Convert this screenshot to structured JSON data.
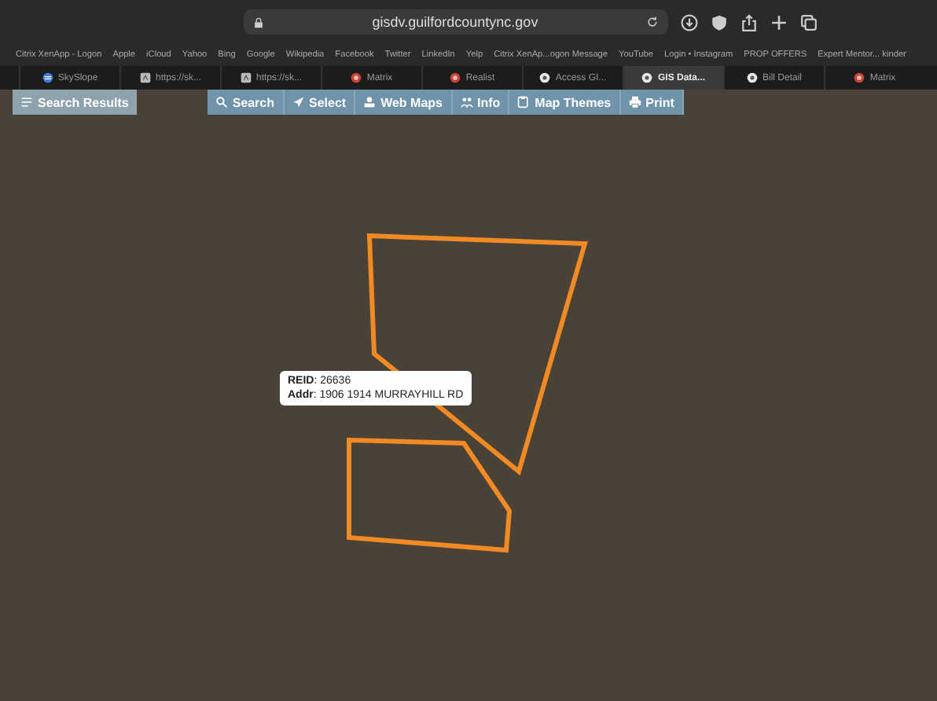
{
  "browser": {
    "address": "gisdv.guilfordcountync.gov",
    "bookmarks": [
      "Citrix XenApp - Logon",
      "Apple",
      "iCloud",
      "Yahoo",
      "Bing",
      "Google",
      "Wikipedia",
      "Facebook",
      "Twitter",
      "LinkedIn",
      "Yelp",
      "Citrix XenAp...ogon Message",
      "YouTube",
      "Login • Instagram",
      "PROP OFFERS",
      "Expert Mentor... kinder"
    ],
    "tabs": [
      {
        "label": "SkySlope",
        "selected": false
      },
      {
        "label": "https://sk...",
        "selected": false
      },
      {
        "label": "https://sk...",
        "selected": false
      },
      {
        "label": "Matrix",
        "selected": false
      },
      {
        "label": "Realist",
        "selected": false
      },
      {
        "label": "Access GI...",
        "selected": false
      },
      {
        "label": "GIS Data...",
        "selected": true
      },
      {
        "label": "Bill Detail",
        "selected": false
      },
      {
        "label": "Matrix",
        "selected": false
      }
    ]
  },
  "gis_toolbar": {
    "results_button": "Search Results",
    "buttons": [
      "Search",
      "Select",
      "Web Maps",
      "Info",
      "Map Themes",
      "Print"
    ]
  },
  "popup": {
    "lines": [
      "**REID**: 26636",
      "**Addr**: 1906 1914 MURRAYHILL RD"
    ]
  }
}
